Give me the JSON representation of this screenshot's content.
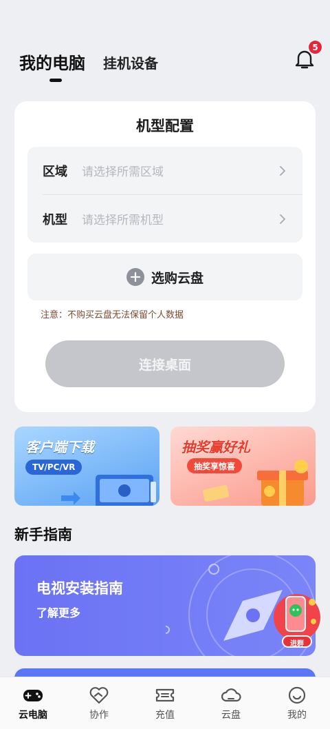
{
  "header": {
    "tabs": [
      {
        "label": "我的电脑",
        "active": true
      },
      {
        "label": "挂机设备",
        "active": false
      }
    ],
    "notification_count": "5"
  },
  "config_card": {
    "title": "机型配置",
    "rows": [
      {
        "label": "区域",
        "placeholder": "请选择所需区域"
      },
      {
        "label": "机型",
        "placeholder": "请选择所需机型"
      }
    ],
    "buy_disk_label": "选购云盘",
    "notice": "注意：不购买云盘无法保留个人数据",
    "connect_label": "连接桌面"
  },
  "banners": [
    {
      "title": "客户端下载",
      "pill": "TV/PC/VR"
    },
    {
      "title": "抽奖赢好礼",
      "pill": "抽奖享惊喜"
    }
  ],
  "guide": {
    "section_title": "新手指南",
    "card_title": "电视安装指南",
    "card_sub": "了解更多",
    "float_label": "进群"
  },
  "bottom_nav": [
    {
      "label": "云电脑",
      "icon": "gamepad-icon",
      "active": true
    },
    {
      "label": "协作",
      "icon": "handshake-heart-icon",
      "active": false
    },
    {
      "label": "充值",
      "icon": "ticket-icon",
      "active": false
    },
    {
      "label": "云盘",
      "icon": "cloud-icon",
      "active": false
    },
    {
      "label": "我的",
      "icon": "smile-icon",
      "active": false
    }
  ],
  "colors": {
    "background": "#eeeff2",
    "badge": "#e8263a",
    "guide_card": "#6b72f4",
    "connect_button": "#c4c6cc"
  }
}
